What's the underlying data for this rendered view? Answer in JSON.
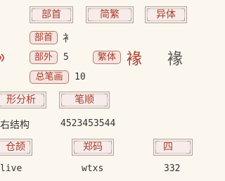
{
  "top_buttons": {
    "radical": "部首",
    "simp_trad": "简繁",
    "variant": "异体"
  },
  "info": {
    "radical_label": "部首",
    "radical_value": "衤",
    "strokes_outside_label": "部外",
    "strokes_outside_value": "5",
    "total_strokes_label": "总笔画",
    "total_strokes_value": "10",
    "traditional_label": "繁体",
    "traditional_char": "褖",
    "variant_char": "褖"
  },
  "section_buttons": {
    "structure": "形分析",
    "stroke_order": "笔顺",
    "cangjie": "仓颉",
    "zhengma": "郑码",
    "four_corner": "四"
  },
  "values": {
    "structure": "右结构",
    "stroke_order": "4523453544",
    "cangjie": "live",
    "zhengma": "wtxs",
    "four_corner": "332"
  },
  "colors": {
    "accent": "#a83d2a",
    "frame": "#b3a49a",
    "background": "#fbf7ef"
  },
  "icons": {
    "audio": "speaker-icon"
  }
}
